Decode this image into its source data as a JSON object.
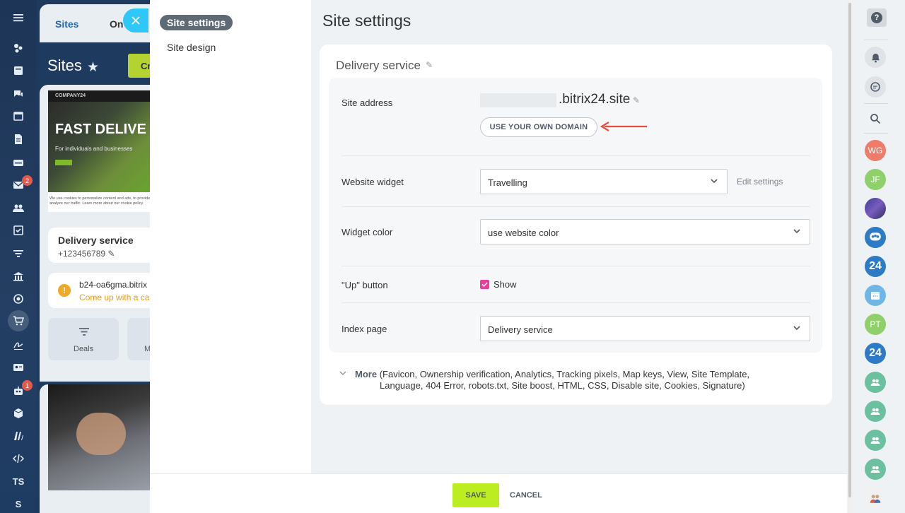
{
  "background": {
    "tabs": [
      "Sites",
      "On"
    ],
    "title": "Sites",
    "create_label": "Cr",
    "preview_brand": "COMPANY24",
    "preview_headline": "FAST DELIVE",
    "preview_sub": "For individuals and businesses",
    "preview_cookie_1": "We use cookies to personalize content and ads, to provide s",
    "preview_cookie_2": "analyze our traffic. Learn more about our cookie policy.",
    "card_title": "Delivery service",
    "card_phone": "+123456789",
    "warn_domain": "b24-oa6gma.bitrix",
    "warn_text": "Come up with a ca",
    "deals_label": "Deals",
    "m_label": "M"
  },
  "leftnav": {
    "mail_badge": "2",
    "robot_badge": "1",
    "ts_label": "TS",
    "s_label": "S"
  },
  "side_menu": {
    "active": "Site settings",
    "items": [
      "Site design"
    ]
  },
  "page_title": "Site settings",
  "card": {
    "title": "Delivery service",
    "site_address_label": "Site address",
    "site_address_value": ".bitrix24.site",
    "own_domain_button": "USE YOUR OWN DOMAIN",
    "widget_label": "Website widget",
    "widget_value": "Travelling",
    "edit_settings": "Edit settings",
    "widget_color_label": "Widget color",
    "widget_color_value": "use website color",
    "up_button_label": "\"Up\" button",
    "up_button_checkbox": "Show",
    "up_button_checked": true,
    "index_page_label": "Index page",
    "index_page_value": "Delivery service",
    "more_label": "More",
    "more_line1": "(Favicon,  Ownership verification,  Analytics,  Tracking pixels,  Map keys,  View,  Site Template,",
    "more_line2": "Language,  404 Error,  robots.txt,  Site boost,  HTML,  CSS,  Disable site,  Cookies,  Signature)"
  },
  "footer": {
    "save": "SAVE",
    "cancel": "CANCEL"
  },
  "rightbar": {
    "help": "?",
    "avatars": [
      {
        "initials": "WG",
        "color": "#ef7b6a"
      },
      {
        "initials": "JF",
        "color": "#8fd06a"
      },
      {
        "initials": "PT",
        "color": "#8fd06a"
      }
    ],
    "badge_24": "24"
  },
  "colors": {
    "accent_cyan": "#2fc7f7",
    "save_green": "#bbed21",
    "checkbox_pink": "#e93e9b",
    "arrow_red": "#ea4d3c",
    "bitrix_blue": "#2d7ac7"
  }
}
